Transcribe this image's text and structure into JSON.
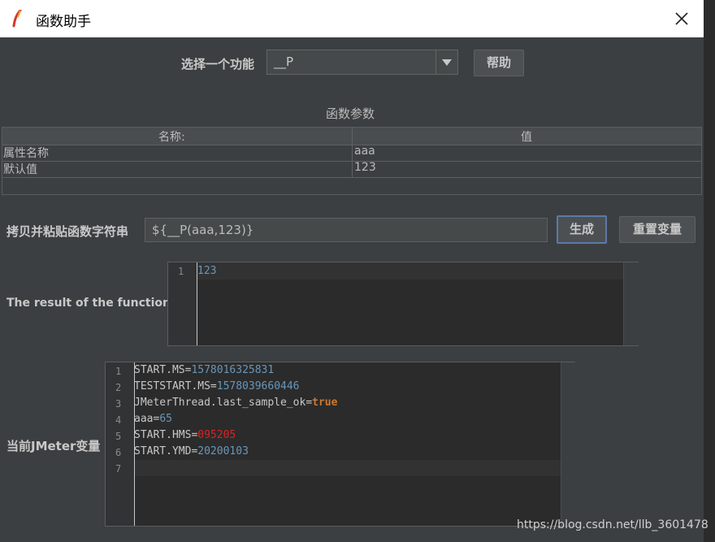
{
  "window": {
    "title": "函数助手",
    "close_icon": "close-icon",
    "app_icon": "feather-icon"
  },
  "function_select": {
    "label": "选择一个功能",
    "value": "__P",
    "help_label": "帮助"
  },
  "params": {
    "section_title": "函数参数",
    "columns": [
      "名称:",
      "值"
    ],
    "rows": [
      {
        "name": "属性名称",
        "value": "aaa"
      },
      {
        "name": "默认值",
        "value": "123"
      }
    ]
  },
  "copy_string": {
    "label": "拷贝并粘贴函数字符串",
    "value": "${__P(aaa,123)}",
    "generate_label": "生成",
    "reset_label": "重置变量"
  },
  "result": {
    "label": "The result of the function is",
    "lines": [
      {
        "num": "1",
        "text": "123"
      }
    ]
  },
  "variables": {
    "label": "当前JMeter变量",
    "lines": [
      {
        "num": "1",
        "key": "START.MS=",
        "val": "1578016325831",
        "style": "n"
      },
      {
        "num": "2",
        "key": "TESTSTART.MS=",
        "val": "1578039660446",
        "style": "n"
      },
      {
        "num": "3",
        "key": "JMeterThread.last_sample_ok=",
        "val": "true",
        "style": "t"
      },
      {
        "num": "4",
        "key": "aaa=",
        "val": "65",
        "style": "n"
      },
      {
        "num": "5",
        "key": "START.HMS=",
        "val": "095205",
        "style": "r"
      },
      {
        "num": "6",
        "key": "START.YMD=",
        "val": "20200103",
        "style": "n"
      },
      {
        "num": "7",
        "key": "",
        "val": "",
        "style": "n"
      }
    ]
  },
  "watermark": "https://blog.csdn.net/llb_3601478"
}
